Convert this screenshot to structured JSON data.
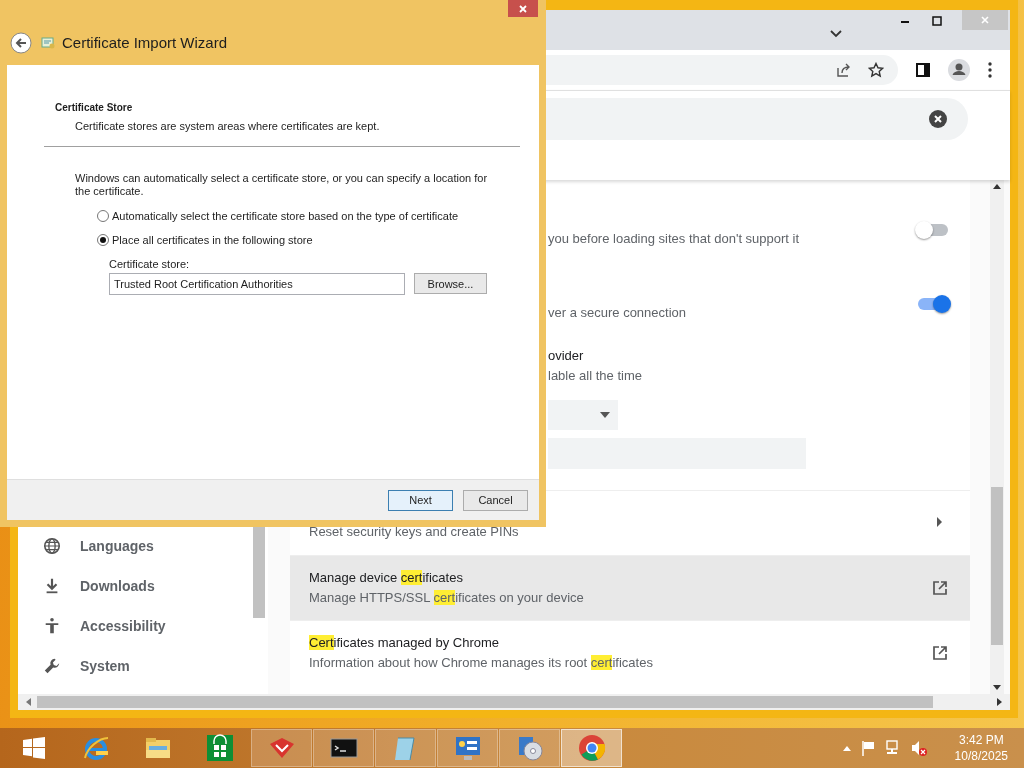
{
  "dialog": {
    "title": "Certificate Import Wizard",
    "section_title": "Certificate Store",
    "section_subtitle": "Certificate stores are system areas where certificates are kept.",
    "intro": "Windows can automatically select a certificate store, or you can specify a location for the certificate.",
    "options": [
      {
        "label": "Automatically select the certificate store based on the type of certificate",
        "selected": false
      },
      {
        "label": "Place all certificates in the following store",
        "selected": true
      }
    ],
    "store_label": "Certificate store:",
    "store_value": "Trusted Root Certification Authorities",
    "browse_button": "Browse...",
    "buttons": [
      {
        "label": "Next",
        "default": true
      },
      {
        "label": "Cancel",
        "default": false
      }
    ]
  },
  "browser": {
    "sidebar": {
      "items": [
        {
          "label": "Languages"
        },
        {
          "label": "Downloads"
        },
        {
          "label": "Accessibility"
        },
        {
          "label": "System"
        }
      ]
    },
    "rows": [
      {
        "kind": "toggle",
        "title": "you before loading sites that don't support it",
        "on": false
      },
      {
        "kind": "toggle",
        "title": "ver a secure connection",
        "on": true,
        "subtitle": "ovider",
        "description": "lable all the time",
        "has_dropdown": true,
        "has_field": true
      },
      {
        "kind": "arrow",
        "title": "Reset security keys and create PINs",
        "hovered": false
      },
      {
        "kind": "external",
        "title": "Manage device **cert**ificates",
        "description": "Manage HTTPS/SSL **cert**ificates on your device",
        "hovered": true
      },
      {
        "kind": "external",
        "title": "**Cert**ificates managed by Chrome",
        "description": "Information about how Chrome manages its root **cert**ificates",
        "hovered": false
      }
    ]
  },
  "taskbar": {
    "apps": [
      {
        "running": false,
        "active": false
      },
      {
        "running": false,
        "active": false
      },
      {
        "running": false,
        "active": false
      },
      {
        "running": false,
        "active": false
      },
      {
        "running": true,
        "active": false
      },
      {
        "running": true,
        "active": false
      },
      {
        "running": true,
        "active": false
      },
      {
        "running": true,
        "active": false
      },
      {
        "running": true,
        "active": false
      },
      {
        "running": true,
        "active": true
      }
    ],
    "time": "3:42 PM",
    "date": "10/8/2025"
  }
}
